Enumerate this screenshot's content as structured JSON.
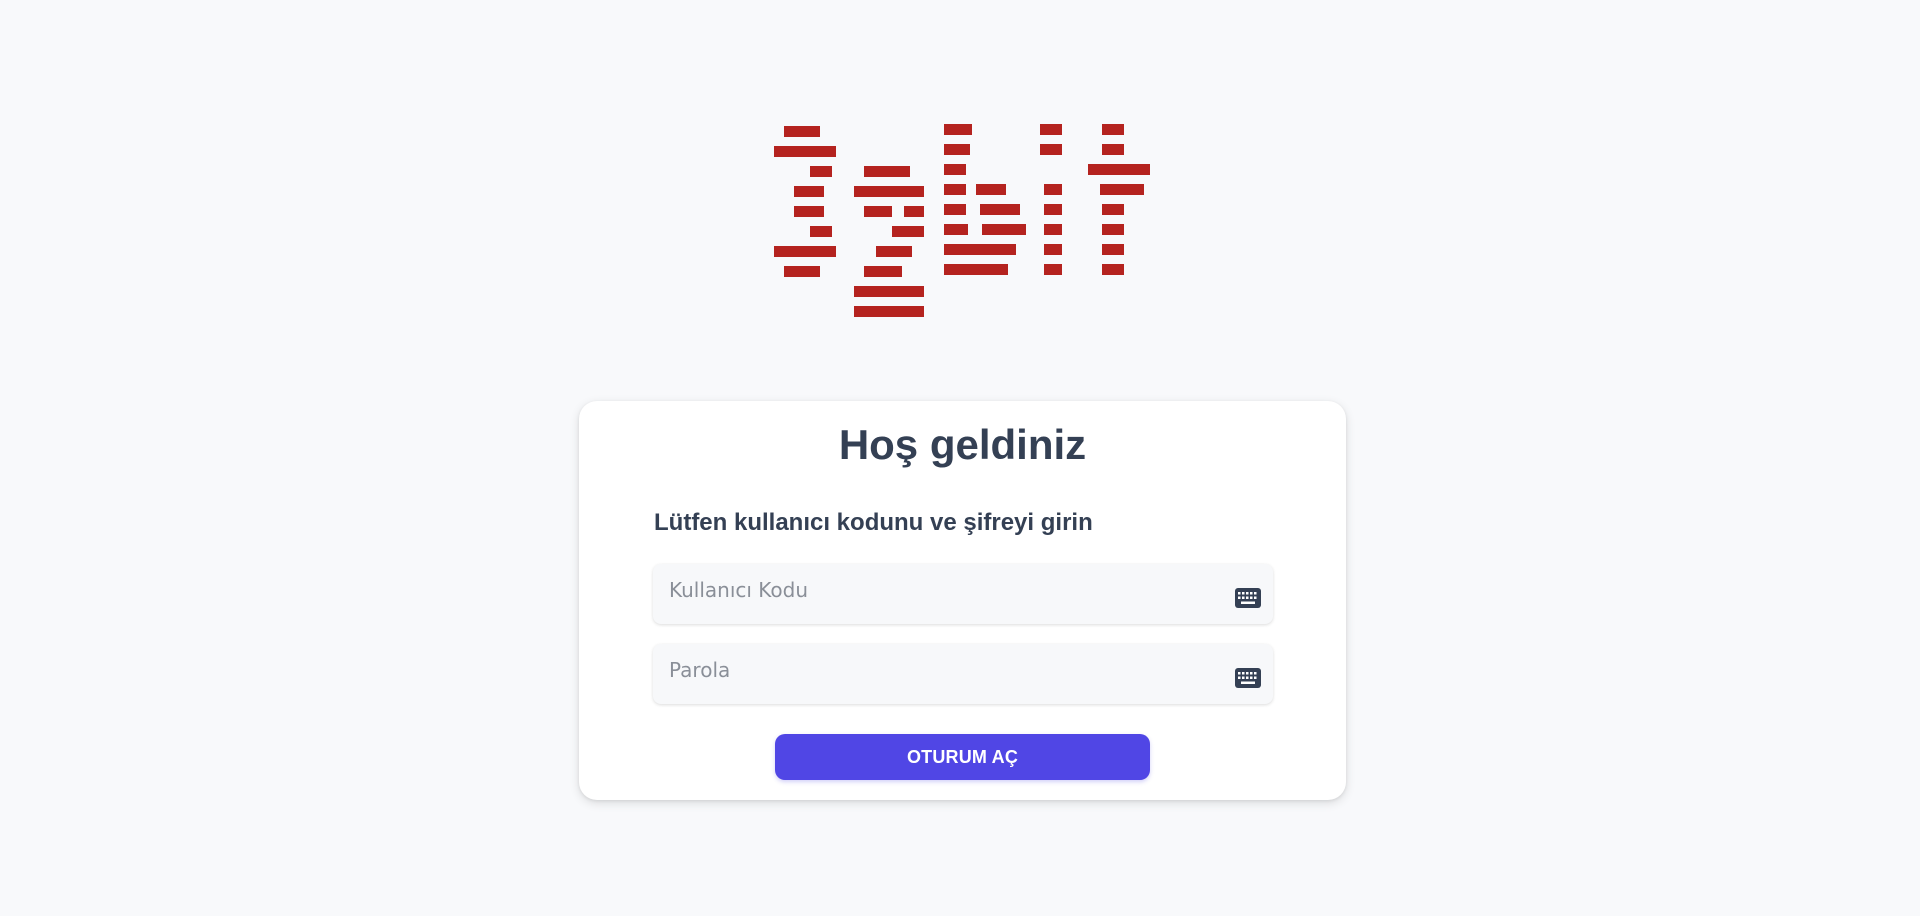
{
  "brand": {
    "logo_text": "izbit",
    "logo_color": "#b5231f"
  },
  "login": {
    "title": "Hoş geldiniz",
    "subtitle": "Lütfen kullanıcı kodunu ve şifreyi girin",
    "username_placeholder": "Kullanıcı Kodu",
    "username_value": "",
    "password_placeholder": "Parola",
    "password_value": "",
    "submit_label": "OTURUM AÇ",
    "keyboard_icon": "keyboard-icon"
  },
  "colors": {
    "background": "#f8f9fb",
    "card": "#ffffff",
    "text": "#344054",
    "button": "#5046e5"
  }
}
